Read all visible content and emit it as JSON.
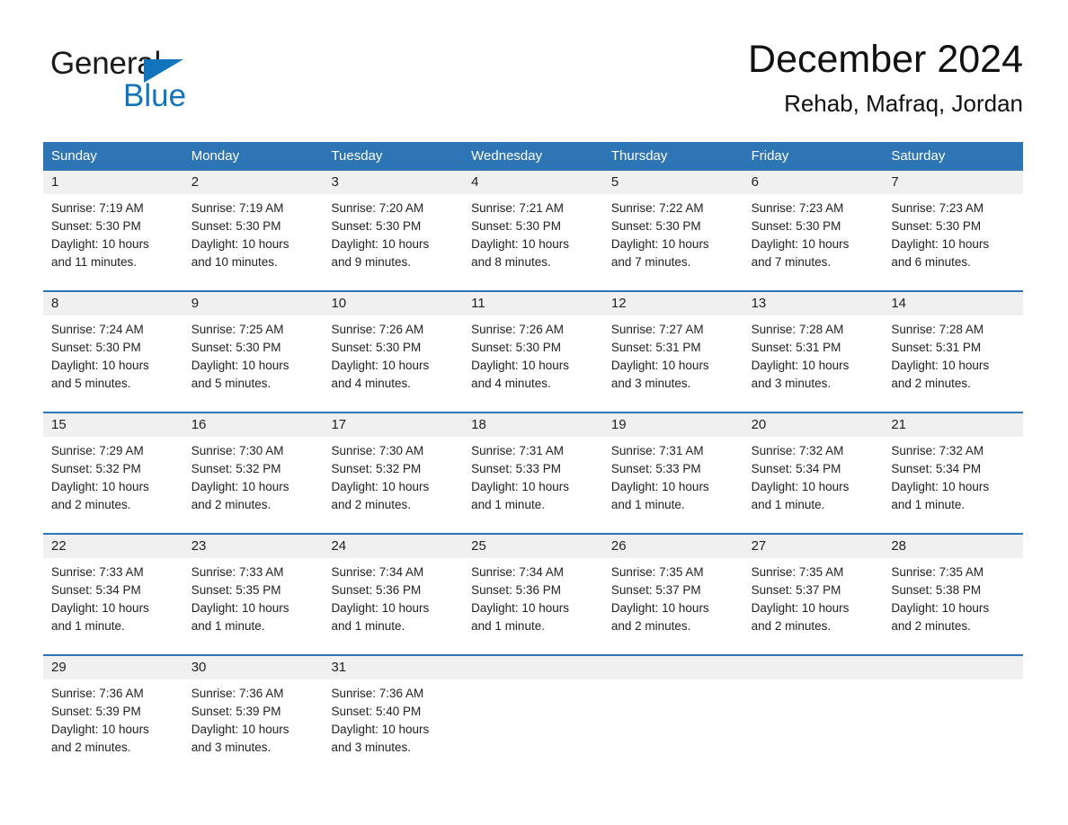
{
  "brand": {
    "name_part1": "General",
    "name_part2": "Blue"
  },
  "header": {
    "title": "December 2024",
    "subtitle": "Rehab, Mafraq, Jordan"
  },
  "colors": {
    "header_blue": "#2e75b6",
    "logo_blue": "#1275bc",
    "date_band": "#f0f0f0"
  },
  "weekdays": [
    "Sunday",
    "Monday",
    "Tuesday",
    "Wednesday",
    "Thursday",
    "Friday",
    "Saturday"
  ],
  "weeks": [
    [
      {
        "day": "1",
        "sunrise": "Sunrise: 7:19 AM",
        "sunset": "Sunset: 5:30 PM",
        "daylight1": "Daylight: 10 hours",
        "daylight2": "and 11 minutes."
      },
      {
        "day": "2",
        "sunrise": "Sunrise: 7:19 AM",
        "sunset": "Sunset: 5:30 PM",
        "daylight1": "Daylight: 10 hours",
        "daylight2": "and 10 minutes."
      },
      {
        "day": "3",
        "sunrise": "Sunrise: 7:20 AM",
        "sunset": "Sunset: 5:30 PM",
        "daylight1": "Daylight: 10 hours",
        "daylight2": "and 9 minutes."
      },
      {
        "day": "4",
        "sunrise": "Sunrise: 7:21 AM",
        "sunset": "Sunset: 5:30 PM",
        "daylight1": "Daylight: 10 hours",
        "daylight2": "and 8 minutes."
      },
      {
        "day": "5",
        "sunrise": "Sunrise: 7:22 AM",
        "sunset": "Sunset: 5:30 PM",
        "daylight1": "Daylight: 10 hours",
        "daylight2": "and 7 minutes."
      },
      {
        "day": "6",
        "sunrise": "Sunrise: 7:23 AM",
        "sunset": "Sunset: 5:30 PM",
        "daylight1": "Daylight: 10 hours",
        "daylight2": "and 7 minutes."
      },
      {
        "day": "7",
        "sunrise": "Sunrise: 7:23 AM",
        "sunset": "Sunset: 5:30 PM",
        "daylight1": "Daylight: 10 hours",
        "daylight2": "and 6 minutes."
      }
    ],
    [
      {
        "day": "8",
        "sunrise": "Sunrise: 7:24 AM",
        "sunset": "Sunset: 5:30 PM",
        "daylight1": "Daylight: 10 hours",
        "daylight2": "and 5 minutes."
      },
      {
        "day": "9",
        "sunrise": "Sunrise: 7:25 AM",
        "sunset": "Sunset: 5:30 PM",
        "daylight1": "Daylight: 10 hours",
        "daylight2": "and 5 minutes."
      },
      {
        "day": "10",
        "sunrise": "Sunrise: 7:26 AM",
        "sunset": "Sunset: 5:30 PM",
        "daylight1": "Daylight: 10 hours",
        "daylight2": "and 4 minutes."
      },
      {
        "day": "11",
        "sunrise": "Sunrise: 7:26 AM",
        "sunset": "Sunset: 5:30 PM",
        "daylight1": "Daylight: 10 hours",
        "daylight2": "and 4 minutes."
      },
      {
        "day": "12",
        "sunrise": "Sunrise: 7:27 AM",
        "sunset": "Sunset: 5:31 PM",
        "daylight1": "Daylight: 10 hours",
        "daylight2": "and 3 minutes."
      },
      {
        "day": "13",
        "sunrise": "Sunrise: 7:28 AM",
        "sunset": "Sunset: 5:31 PM",
        "daylight1": "Daylight: 10 hours",
        "daylight2": "and 3 minutes."
      },
      {
        "day": "14",
        "sunrise": "Sunrise: 7:28 AM",
        "sunset": "Sunset: 5:31 PM",
        "daylight1": "Daylight: 10 hours",
        "daylight2": "and 2 minutes."
      }
    ],
    [
      {
        "day": "15",
        "sunrise": "Sunrise: 7:29 AM",
        "sunset": "Sunset: 5:32 PM",
        "daylight1": "Daylight: 10 hours",
        "daylight2": "and 2 minutes."
      },
      {
        "day": "16",
        "sunrise": "Sunrise: 7:30 AM",
        "sunset": "Sunset: 5:32 PM",
        "daylight1": "Daylight: 10 hours",
        "daylight2": "and 2 minutes."
      },
      {
        "day": "17",
        "sunrise": "Sunrise: 7:30 AM",
        "sunset": "Sunset: 5:32 PM",
        "daylight1": "Daylight: 10 hours",
        "daylight2": "and 2 minutes."
      },
      {
        "day": "18",
        "sunrise": "Sunrise: 7:31 AM",
        "sunset": "Sunset: 5:33 PM",
        "daylight1": "Daylight: 10 hours",
        "daylight2": "and 1 minute."
      },
      {
        "day": "19",
        "sunrise": "Sunrise: 7:31 AM",
        "sunset": "Sunset: 5:33 PM",
        "daylight1": "Daylight: 10 hours",
        "daylight2": "and 1 minute."
      },
      {
        "day": "20",
        "sunrise": "Sunrise: 7:32 AM",
        "sunset": "Sunset: 5:34 PM",
        "daylight1": "Daylight: 10 hours",
        "daylight2": "and 1 minute."
      },
      {
        "day": "21",
        "sunrise": "Sunrise: 7:32 AM",
        "sunset": "Sunset: 5:34 PM",
        "daylight1": "Daylight: 10 hours",
        "daylight2": "and 1 minute."
      }
    ],
    [
      {
        "day": "22",
        "sunrise": "Sunrise: 7:33 AM",
        "sunset": "Sunset: 5:34 PM",
        "daylight1": "Daylight: 10 hours",
        "daylight2": "and 1 minute."
      },
      {
        "day": "23",
        "sunrise": "Sunrise: 7:33 AM",
        "sunset": "Sunset: 5:35 PM",
        "daylight1": "Daylight: 10 hours",
        "daylight2": "and 1 minute."
      },
      {
        "day": "24",
        "sunrise": "Sunrise: 7:34 AM",
        "sunset": "Sunset: 5:36 PM",
        "daylight1": "Daylight: 10 hours",
        "daylight2": "and 1 minute."
      },
      {
        "day": "25",
        "sunrise": "Sunrise: 7:34 AM",
        "sunset": "Sunset: 5:36 PM",
        "daylight1": "Daylight: 10 hours",
        "daylight2": "and 1 minute."
      },
      {
        "day": "26",
        "sunrise": "Sunrise: 7:35 AM",
        "sunset": "Sunset: 5:37 PM",
        "daylight1": "Daylight: 10 hours",
        "daylight2": "and 2 minutes."
      },
      {
        "day": "27",
        "sunrise": "Sunrise: 7:35 AM",
        "sunset": "Sunset: 5:37 PM",
        "daylight1": "Daylight: 10 hours",
        "daylight2": "and 2 minutes."
      },
      {
        "day": "28",
        "sunrise": "Sunrise: 7:35 AM",
        "sunset": "Sunset: 5:38 PM",
        "daylight1": "Daylight: 10 hours",
        "daylight2": "and 2 minutes."
      }
    ],
    [
      {
        "day": "29",
        "sunrise": "Sunrise: 7:36 AM",
        "sunset": "Sunset: 5:39 PM",
        "daylight1": "Daylight: 10 hours",
        "daylight2": "and 2 minutes."
      },
      {
        "day": "30",
        "sunrise": "Sunrise: 7:36 AM",
        "sunset": "Sunset: 5:39 PM",
        "daylight1": "Daylight: 10 hours",
        "daylight2": "and 3 minutes."
      },
      {
        "day": "31",
        "sunrise": "Sunrise: 7:36 AM",
        "sunset": "Sunset: 5:40 PM",
        "daylight1": "Daylight: 10 hours",
        "daylight2": "and 3 minutes."
      },
      {
        "day": "",
        "sunrise": "",
        "sunset": "",
        "daylight1": "",
        "daylight2": ""
      },
      {
        "day": "",
        "sunrise": "",
        "sunset": "",
        "daylight1": "",
        "daylight2": ""
      },
      {
        "day": "",
        "sunrise": "",
        "sunset": "",
        "daylight1": "",
        "daylight2": ""
      },
      {
        "day": "",
        "sunrise": "",
        "sunset": "",
        "daylight1": "",
        "daylight2": ""
      }
    ]
  ]
}
